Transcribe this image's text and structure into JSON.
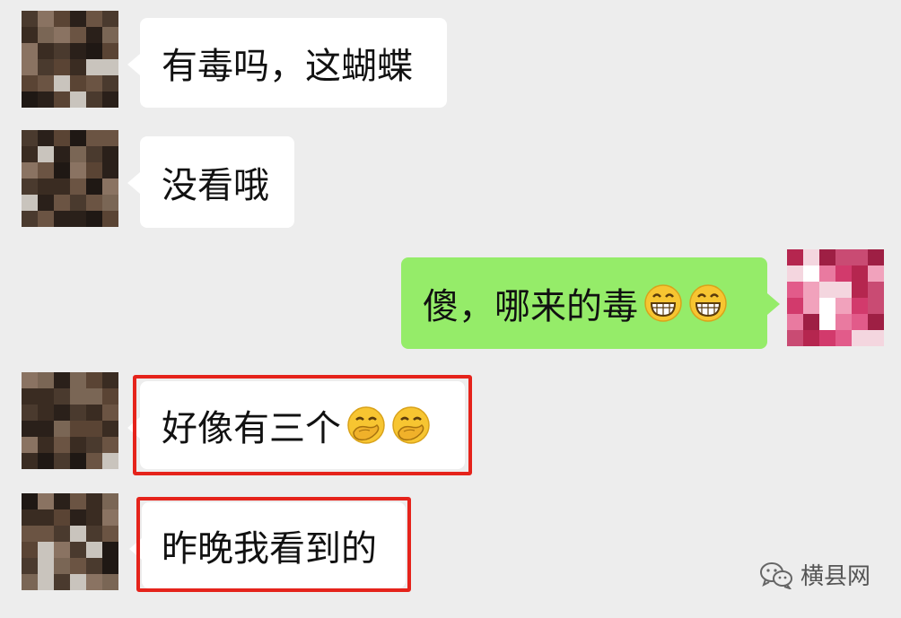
{
  "messages": [
    {
      "side": "left",
      "text": "有毒吗，这蝴蝶",
      "emojis": []
    },
    {
      "side": "left",
      "text": "没看哦",
      "emojis": []
    },
    {
      "side": "right",
      "text": "傻，哪来的毒",
      "emojis": [
        "grinning-face-icon",
        "grinning-face-icon"
      ]
    },
    {
      "side": "left",
      "text": "好像有三个",
      "emojis": [
        "hand-over-mouth-face-icon",
        "hand-over-mouth-face-icon"
      ],
      "highlighted": true
    },
    {
      "side": "left",
      "text": "昨晚我看到的",
      "emojis": [],
      "highlighted": true
    }
  ],
  "watermark": {
    "text": "横县网",
    "icon": "wechat-icon"
  },
  "colors": {
    "background": "#ededed",
    "bubble_received": "#ffffff",
    "bubble_sent": "#95ec69",
    "highlight_box": "#e5231b"
  }
}
